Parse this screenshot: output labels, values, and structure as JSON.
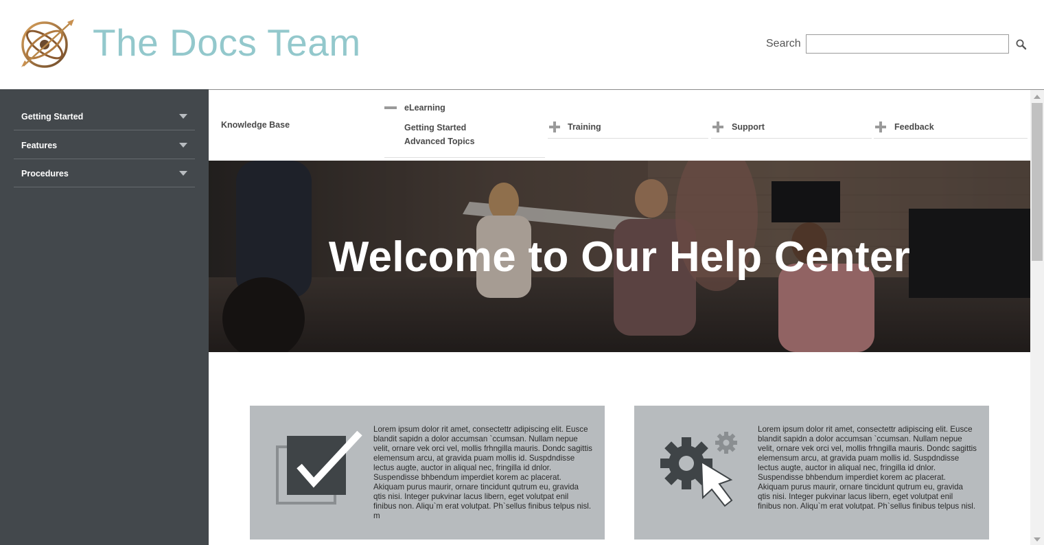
{
  "header": {
    "title": "The Docs Team",
    "search_label": "Search",
    "search_value": "",
    "search_placeholder": ""
  },
  "sidebar": {
    "items": [
      {
        "label": "Getting Started"
      },
      {
        "label": "Features"
      },
      {
        "label": "Procedures"
      }
    ]
  },
  "topnav": {
    "knowledge_base": "Knowledge Base",
    "elearning": {
      "label": "eLearning",
      "children": [
        "Getting Started",
        "Advanced Topics"
      ]
    },
    "training": "Training",
    "support": "Support",
    "feedback": "Feedback"
  },
  "hero": {
    "title": "Welcome to Our Help Center"
  },
  "cards": [
    {
      "icon": "checkbox-icon",
      "text": "Lorem ipsum dolor rit amet, consectettr adipiscing elit. Eusce blandit sapidn a dolor accumsan `ccumsan. Nullam nepue velit, ornare vek orci vel, mollis frhngilla mauris. Dondc sagittis elemensum arcu, at gravida puam mollis id. Suspdndisse lectus augte, auctor in aliqual nec, fringilla id dnlor. Suspendisse bhbendum imperdiet korem ac placerat. Akiquam purus maurir, ornare tincidunt qutrum eu, gravida qtis nisi. Integer pukvinar lacus libern, eget volutpat enil finibus non. Aliqu`m erat volutpat. Ph`sellus finibus telpus nisl. m"
    },
    {
      "icon": "settings-cursor-icon",
      "text": "Lorem ipsum dolor rit amet, consectettr adipiscing elit. Eusce blandit sapidn a dolor accumsan `ccumsan. Nullam nepue velit, ornare vek orci vel, mollis frhngilla mauris. Dondc sagittis elemensum arcu, at gravida puam mollis id. Suspdndisse lectus augte, auctor in aliqual nec, fringilla id dnlor. Suspendisse bhbendum imperdiet korem ac placerat. Akiquam purus maurir, ornare tincidunt qutrum eu, gravida qtis nisi. Integer pukvinar lacus libern, eget volutpat enil finibus non. Aliqu`m erat volutpat. Ph`sellus finibus telpus nisl."
    }
  ],
  "colors": {
    "title": "#93c8cc",
    "sidebar_bg": "#43484c",
    "card_bg": "#b7bbbe",
    "icon_dark": "#3f4447"
  }
}
